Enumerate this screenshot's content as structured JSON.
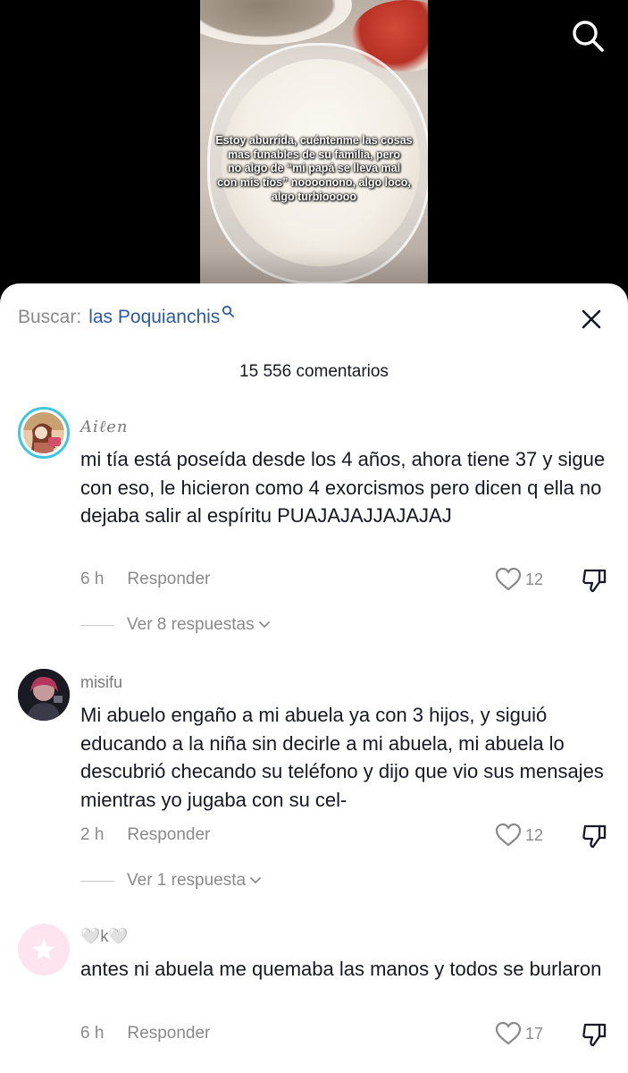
{
  "video": {
    "caption": "Estoy aburrida, cuéntenme las cosas\nmas funables de su familia, pero\nno algo de “mi papá se lleva mal\ncon mis tíos” noooonono, algo loco,\nalgo turbiooooo"
  },
  "search": {
    "prefix": "Buscar:",
    "query": "las Poquianchis"
  },
  "comments_count": "15 556 comentarios",
  "comments": [
    {
      "author": "Aiℓen",
      "text": "mi tía está poseída desde los 4 años, ahora tiene 37 y sigue con eso, le hicieron como 4 exorcismos pero dicen q ella no dejaba salir al espíritu PUAJAJAJJAJAJAJ",
      "time": "6 h",
      "reply_label": "Responder",
      "likes": "12",
      "replies_label": "Ver 8 respuestas"
    },
    {
      "author": "misifu",
      "text": "Mi abuelo engaño a mi abuela ya con 3 hijos, y siguió educando a la niña sin decirle a mi abuela, mi abuela lo descubrió checando su teléfono y dijo que vio sus mensajes mientras yo jugaba con su cel-",
      "time": "2 h",
      "reply_label": "Responder",
      "likes": "12",
      "replies_label": "Ver 1 respuesta"
    },
    {
      "author": "🤍k🤍",
      "text": "antes ni abuela me quemaba las manos y todos se burlaron",
      "time": "6 h",
      "reply_label": "Responder",
      "likes": "17"
    }
  ],
  "colors": {
    "accent_link": "#2c5aa0",
    "secondary_text": "#8a8a8a",
    "primary_text": "#161823",
    "avatar_ring": "#3ec6e0",
    "placeholder_avatar": "#fde4ee"
  },
  "icons": [
    "search-icon",
    "close-icon",
    "heart-icon",
    "dislike-icon",
    "chevron-down-icon",
    "star-icon"
  ]
}
